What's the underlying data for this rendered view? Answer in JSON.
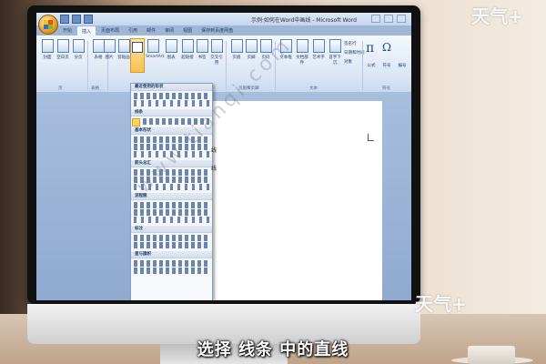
{
  "window": {
    "title": "示例·如何在Word中画线 - Microsoft Word"
  },
  "tabs": [
    {
      "label": "开始"
    },
    {
      "label": "插入"
    },
    {
      "label": "页面布局"
    },
    {
      "label": "引用"
    },
    {
      "label": "邮件"
    },
    {
      "label": "审阅"
    },
    {
      "label": "视图"
    },
    {
      "label": "保存到百度网盘"
    }
  ],
  "ribbon": {
    "buttons": [
      {
        "label": "封面"
      },
      {
        "label": "空白页"
      },
      {
        "label": "分页"
      },
      {
        "label": "表格"
      },
      {
        "label": "图片"
      },
      {
        "label": "剪贴画"
      },
      {
        "label": "形状"
      },
      {
        "label": "SmartArt"
      },
      {
        "label": "图表"
      },
      {
        "label": "超链接"
      },
      {
        "label": "书签"
      },
      {
        "label": "交叉引用"
      },
      {
        "label": "页眉"
      },
      {
        "label": "页脚"
      },
      {
        "label": "页码"
      },
      {
        "label": "文本框"
      },
      {
        "label": "文档部件"
      },
      {
        "label": "艺术字"
      },
      {
        "label": "首字下沉"
      },
      {
        "label": "公式"
      },
      {
        "label": "符号"
      },
      {
        "label": "编号"
      }
    ],
    "small_items": [
      {
        "label": "签名行"
      },
      {
        "label": "日期和时间"
      },
      {
        "label": "对象"
      }
    ],
    "groups": [
      {
        "label": "页"
      },
      {
        "label": "表格"
      },
      {
        "label": "页眉和页脚"
      },
      {
        "label": "文本"
      },
      {
        "label": "符号"
      }
    ],
    "pi_symbol": "π",
    "omega_symbol": "Ω"
  },
  "shapes_menu": {
    "sections": [
      {
        "label": "最近使用的形状"
      },
      {
        "label": "线条"
      },
      {
        "label": "基本形状"
      },
      {
        "label": "箭头总汇"
      },
      {
        "label": "流程图"
      },
      {
        "label": "标注"
      },
      {
        "label": "星与旗帜"
      }
    ],
    "pointer_label": "线"
  },
  "overlay": {
    "caption": "选择 线条 中的直线",
    "watermark": "www.tianqi.com",
    "brand": "天气+"
  },
  "colors": {
    "ribbon": "#dbe7f5",
    "highlight": "#ffd25e",
    "caption_text": "#ffffff"
  }
}
